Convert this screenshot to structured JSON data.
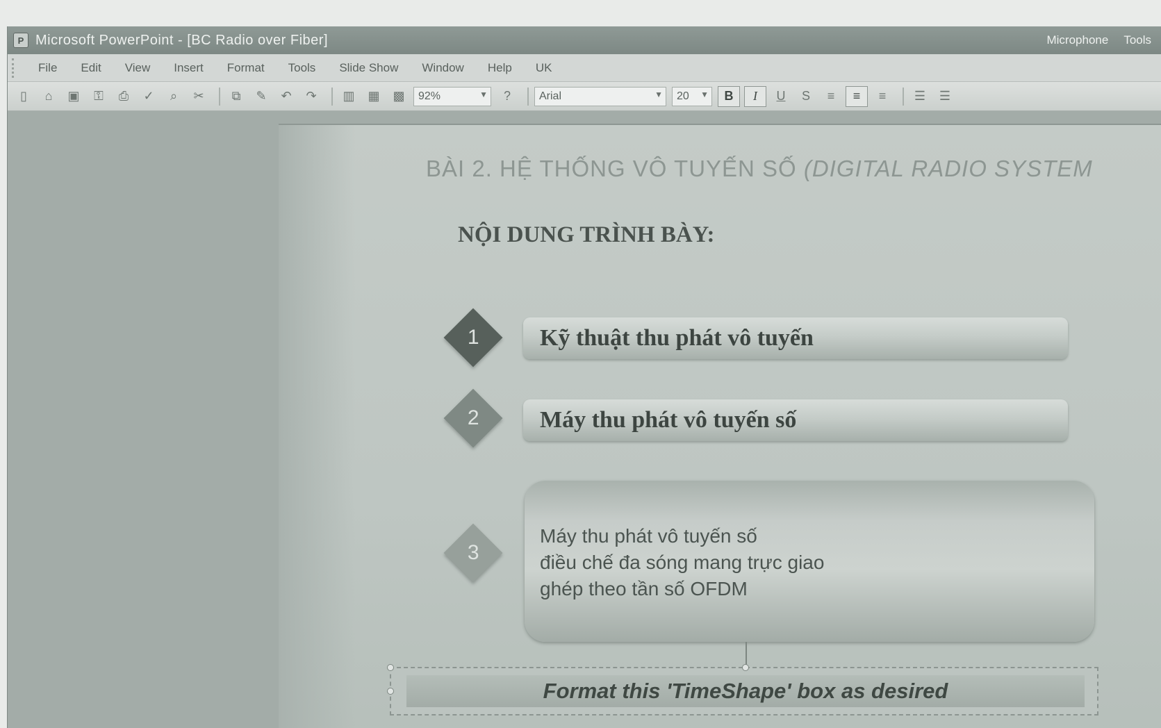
{
  "titlebar": {
    "title": "Microsoft PowerPoint - [BC Radio over Fiber]",
    "right_items": [
      "Microphone",
      "Tools"
    ]
  },
  "menubar": {
    "items": [
      "File",
      "Edit",
      "View",
      "Insert",
      "Format",
      "Tools",
      "Slide Show",
      "Window",
      "Help",
      "UK"
    ]
  },
  "toolbar": {
    "zoom": "92%",
    "font": "Arial",
    "font_size": "20",
    "bold": "B",
    "italic": "I",
    "underline": "U",
    "shadow": "S"
  },
  "slide": {
    "title_main": "BÀI 2. HỆ THỐNG VÔ TUYẾN SỐ ",
    "title_italic": "(DIGITAL RADIO SYSTEM",
    "heading": "NỘI DUNG TRÌNH BÀY:",
    "items": [
      {
        "number": "1",
        "label": "Kỹ thuật thu phát vô tuyến"
      },
      {
        "number": "2",
        "label": "Máy thu phát vô tuyến số"
      },
      {
        "number": "3",
        "lines": [
          "Máy thu phát vô tuyến số",
          "điều chế đa sóng mang trực giao",
          "ghép theo tần số OFDM"
        ]
      }
    ],
    "timeshape_text": "Format this 'TimeShape' box as desired"
  },
  "colors": {
    "diamond_1": "#57605b",
    "diamond_2": "#7f8984",
    "diamond_3": "#97a09b"
  }
}
